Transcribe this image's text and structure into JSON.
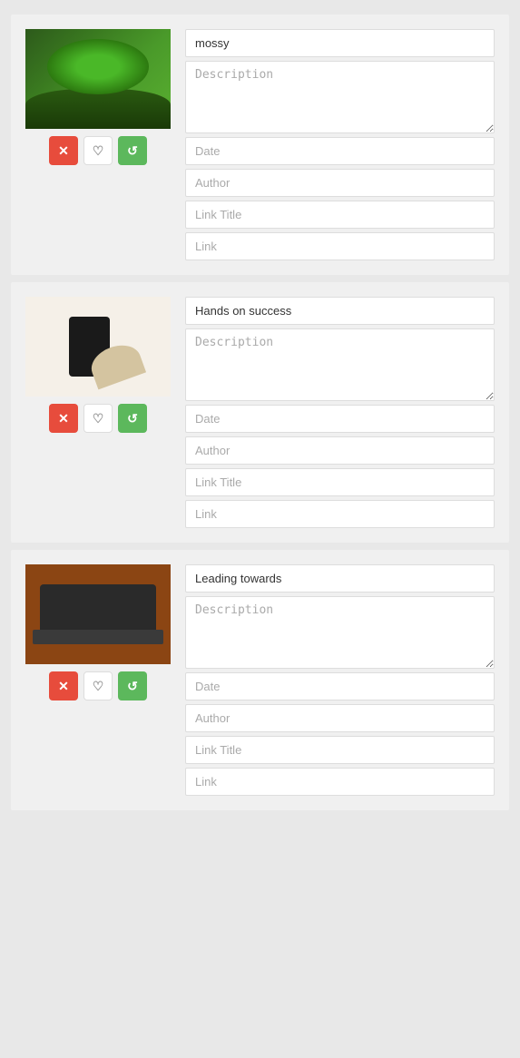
{
  "cards": [
    {
      "id": "card-1",
      "title": "mossy",
      "title_placeholder": "mossy",
      "description_placeholder": "Description",
      "date_placeholder": "Date",
      "author_placeholder": "Author",
      "link_title_placeholder": "Link Title",
      "link_placeholder": "Link",
      "thumb_type": "mossy"
    },
    {
      "id": "card-2",
      "title": "Hands on success",
      "title_placeholder": "Hands on success",
      "description_placeholder": "Description",
      "date_placeholder": "Date",
      "author_placeholder": "Author",
      "link_title_placeholder": "Link Title",
      "link_placeholder": "Link",
      "thumb_type": "phone"
    },
    {
      "id": "card-3",
      "title": "Leading towards",
      "title_placeholder": "Leading towards",
      "description_placeholder": "Description",
      "date_placeholder": "Date",
      "author_placeholder": "Author",
      "link_title_placeholder": "Link Title",
      "link_placeholder": "Link",
      "thumb_type": "laptop"
    }
  ],
  "buttons": {
    "delete_label": "✕",
    "heart_label": "♡",
    "refresh_label": "↺"
  }
}
